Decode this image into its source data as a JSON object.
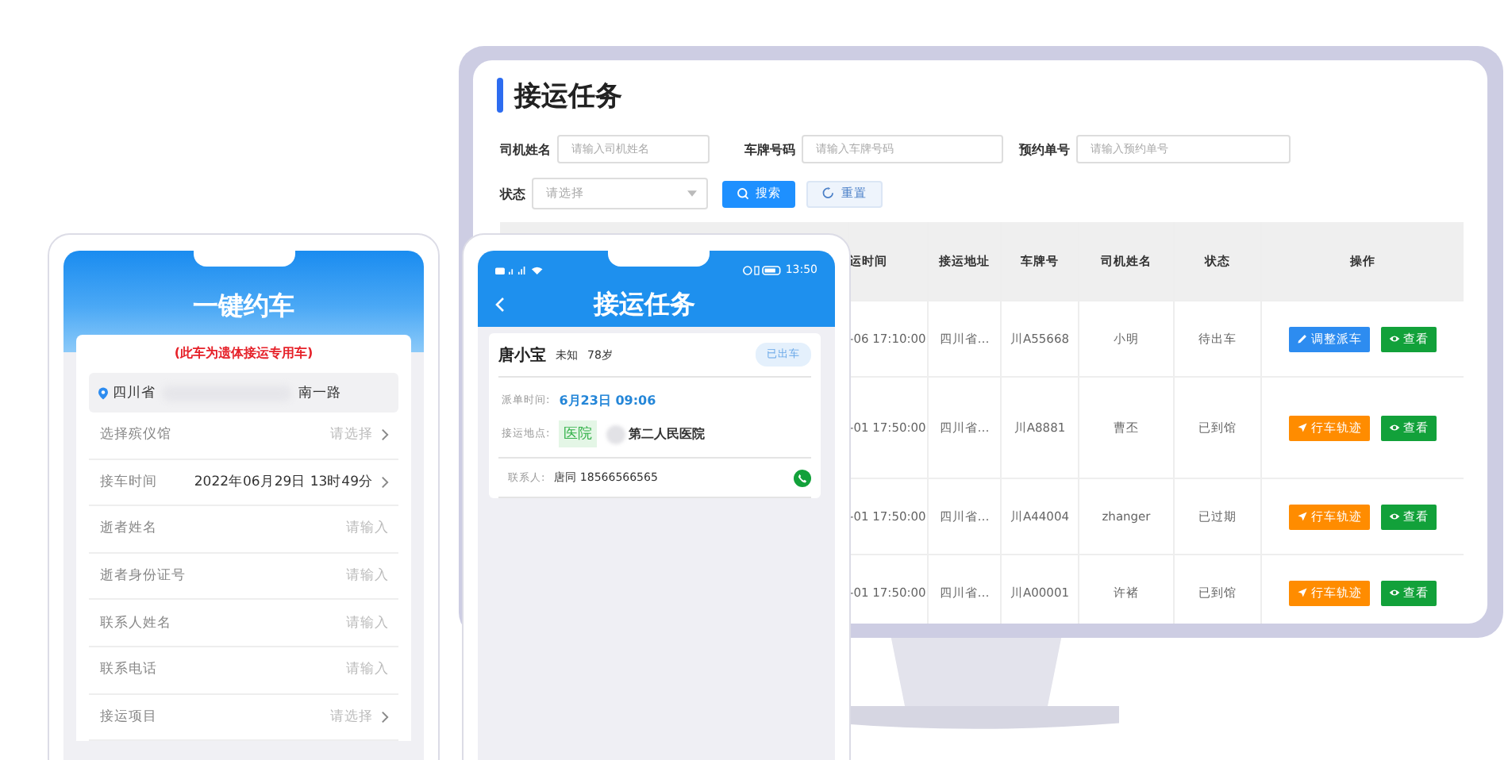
{
  "desktop": {
    "title": "接运任务",
    "filters": [
      {
        "label": "司机姓名",
        "placeholder": "请输入司机姓名"
      },
      {
        "label": "车牌号码",
        "placeholder": "请输入车牌号码"
      },
      {
        "label": "预约单号",
        "placeholder": "请输入预约单号"
      }
    ],
    "status_filter": {
      "label": "状态",
      "placeholder": "请选择"
    },
    "buttons": [
      {
        "label": "搜索",
        "kind": "primary"
      },
      {
        "label": "重置",
        "kind": "secondary"
      }
    ],
    "table": {
      "columns": [
        "运时间",
        "接运地址",
        "车牌号",
        "司机姓名",
        "状态",
        "操作"
      ],
      "rows": [
        {
          "cells": [
            "-06 17:10:00",
            "四川省…",
            "川A55668",
            "小明",
            "待出车"
          ],
          "actions": [
            {
              "label": "调整派车",
              "kind": "edit"
            },
            {
              "label": "查看",
              "kind": "view"
            }
          ]
        },
        {
          "cells": [
            "-01 17:50:00",
            "四川省…",
            "川A8881",
            "曹丕",
            "已到馆"
          ],
          "actions": [
            {
              "label": "行车轨迹",
              "kind": "track"
            },
            {
              "label": "查看",
              "kind": "view"
            }
          ]
        },
        {
          "cells": [
            "-01 17:50:00",
            "四川省…",
            "川A44004",
            "zhanger",
            "已过期"
          ],
          "actions": [
            {
              "label": "行车轨迹",
              "kind": "track"
            },
            {
              "label": "查看",
              "kind": "view"
            }
          ]
        },
        {
          "cells": [
            "-01 17:50:00",
            "四川省…",
            "川A00001",
            "许褚",
            "已到馆"
          ],
          "actions": [
            {
              "label": "行车轨迹",
              "kind": "track"
            },
            {
              "label": "查看",
              "kind": "view"
            }
          ]
        }
      ]
    }
  },
  "booking_phone": {
    "title": "一键约车",
    "notice": "(此车为遗体接运专用车)",
    "address": {
      "province": "四川省",
      "street": "南一路"
    },
    "fields": [
      {
        "label": "选择殡仪馆",
        "placeholder": "请选择",
        "kind": "select"
      },
      {
        "label": "接车时间",
        "value": "2022年06月29日 13时49分",
        "kind": "select"
      },
      {
        "label": "逝者姓名",
        "placeholder": "请输入",
        "kind": "input"
      },
      {
        "label": "逝者身份证号",
        "placeholder": "请输入",
        "kind": "input"
      },
      {
        "label": "联系人姓名",
        "placeholder": "请输入",
        "kind": "input"
      },
      {
        "label": "联系电话",
        "placeholder": "请输入",
        "kind": "input"
      },
      {
        "label": "接运项目",
        "placeholder": "请选择",
        "kind": "select"
      }
    ]
  },
  "task_phone": {
    "time": "13:50",
    "title": "接运任务",
    "card": {
      "name": "唐小宝",
      "gender": "未知",
      "age": "78岁",
      "status": "已出车",
      "dispatch_label": "派单时间:",
      "dispatch_time": "6月23日 09:06",
      "place_label": "接运地点:",
      "place_tag": "医院",
      "place": "第二人民医院",
      "contact_label": "联系人:",
      "contact": "唐同  18566566565"
    }
  }
}
